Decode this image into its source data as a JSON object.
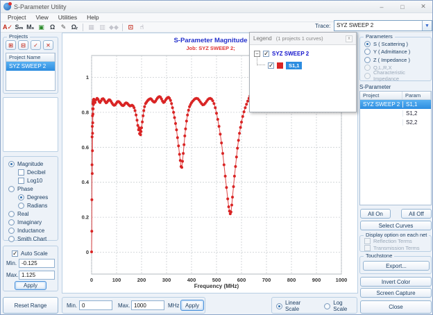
{
  "window": {
    "title": "S-Parameter Utility",
    "controls": [
      {
        "name": "minimize-button",
        "glyph": "–"
      },
      {
        "name": "maximize-button",
        "glyph": "□"
      },
      {
        "name": "close-button",
        "glyph": "✕"
      }
    ]
  },
  "menu": [
    "Project",
    "View",
    "Utilities",
    "Help"
  ],
  "toolbar": {
    "trace_label": "Trace:",
    "trace_value": "SYZ SWEEP 2",
    "items": [
      {
        "name": "ac-check-icon",
        "glyph": "A✓",
        "color": "#c22516"
      },
      {
        "name": "s-to-m-convert-icon",
        "glyph": "Sₘ",
        "color": "#333b44"
      },
      {
        "name": "m-to-s-convert-icon",
        "glyph": "Mₛ",
        "color": "#333b44"
      },
      {
        "name": "import-data-icon",
        "glyph": "▣",
        "color": "#2a8a2a"
      },
      {
        "name": "impedance-omega-icon",
        "glyph": "Ω",
        "color": "#333b44"
      },
      {
        "name": "edit-plot-icon",
        "glyph": "✎",
        "color": "#555"
      },
      {
        "name": "omega-r-icon",
        "glyph": "Ωᵣ",
        "color": "#333b44"
      },
      {
        "sep": true
      },
      {
        "name": "table-column-left-icon",
        "glyph": "▦",
        "color": "#778",
        "disabled": true
      },
      {
        "name": "table-column-right-icon",
        "glyph": "▥",
        "color": "#778",
        "disabled": true
      },
      {
        "name": "markers-icon",
        "glyph": "◆◆",
        "color": "#778",
        "disabled": true
      },
      {
        "sep": true
      },
      {
        "name": "zoom-select-icon",
        "glyph": "⊡",
        "color": "#c22516"
      },
      {
        "name": "pan-hand-icon",
        "glyph": "☝",
        "color": "#667"
      }
    ]
  },
  "projects_panel": {
    "title": "Projects",
    "buttons": [
      {
        "name": "add-project-button",
        "glyph": "⊞"
      },
      {
        "name": "remove-project-button",
        "glyph": "⊟"
      },
      {
        "name": "confirm-project-button",
        "glyph": "✓"
      },
      {
        "name": "delete-project-button",
        "glyph": "✕"
      }
    ],
    "column_header": "Project Name",
    "rows": [
      {
        "label": "SYZ SWEEP 2",
        "selected": true
      }
    ]
  },
  "display_options": {
    "items": [
      {
        "type": "radio",
        "label": "Magnitude",
        "checked": true,
        "indent": 0
      },
      {
        "type": "check",
        "label": "Decibel",
        "checked": false,
        "indent": 1
      },
      {
        "type": "check",
        "label": "Log10",
        "checked": false,
        "indent": 1
      },
      {
        "type": "radio",
        "label": "Phase",
        "checked": false,
        "indent": 0
      },
      {
        "type": "radio",
        "label": "Degrees",
        "checked": true,
        "indent": 1
      },
      {
        "type": "radio",
        "label": "Radians",
        "checked": false,
        "indent": 1
      },
      {
        "type": "radio",
        "label": "Real",
        "checked": false,
        "indent": 0
      },
      {
        "type": "radio",
        "label": "Imaginary",
        "checked": false,
        "indent": 0
      },
      {
        "type": "radio",
        "label": "Inductance",
        "checked": false,
        "indent": 0
      },
      {
        "type": "radio",
        "label": "Smith Chart",
        "checked": false,
        "indent": 0
      }
    ]
  },
  "scale_panel": {
    "auto_scale_label": "Auto Scale",
    "auto_scale_checked": true,
    "min_label": "Min.",
    "min_value": "-0.125",
    "max_label": "Max.",
    "max_value": "1.125",
    "apply_label": "Apply"
  },
  "reset_range_label": "Reset Range",
  "legend": {
    "title": "Legend",
    "count_text": "(1 projects 1 curves)",
    "close_glyph": "x",
    "expander_glyph": "−",
    "project": "SYZ SWEEP 2",
    "curve": "S1,1"
  },
  "parameters_panel": {
    "title": "Parameters",
    "options": [
      {
        "label": "S ( Scattering )",
        "checked": true,
        "disabled": false
      },
      {
        "label": "Y ( Admittance )",
        "checked": false,
        "disabled": false
      },
      {
        "label": "Z ( Impedance )",
        "checked": false,
        "disabled": false
      },
      {
        "label": "Q,L,R,X",
        "checked": false,
        "disabled": true
      },
      {
        "label": "Characteristic Impedance",
        "checked": false,
        "disabled": true
      }
    ]
  },
  "sparameter_panel": {
    "title": "S-Parameter",
    "columns": [
      "Project",
      "Param"
    ],
    "rows": [
      {
        "project": "SYZ SWEEP 2",
        "param": "S1,1",
        "selected": true
      },
      {
        "project": "",
        "param": "S1,2",
        "selected": false
      },
      {
        "project": "",
        "param": "S2,2",
        "selected": false
      }
    ],
    "all_on_label": "All On",
    "all_off_label": "All Off",
    "select_curves_label": "Select Curves"
  },
  "net_options": {
    "title": "Display option on each net",
    "items": [
      {
        "label": "Reflection Terms",
        "checked": false,
        "disabled": true
      },
      {
        "label": "Transmission Terms",
        "checked": false,
        "disabled": true
      }
    ]
  },
  "touchstone": {
    "title": "Touchstone",
    "export_label": "Export..."
  },
  "side_buttons": {
    "invert_color": "Invert Color",
    "screen_capture": "Screen Capture",
    "close": "Close"
  },
  "freq_range": {
    "min_label": "Min.",
    "min_value": "0",
    "max_label": "Max.",
    "max_value": "1000",
    "unit": "MHz",
    "apply_label": "Apply"
  },
  "x_scale": {
    "options": [
      {
        "label": "Linear Scale",
        "checked": true
      },
      {
        "label": "Log Scale",
        "checked": false
      }
    ]
  },
  "chart_data": {
    "type": "line",
    "title": "S-Parameter Magnitude",
    "subtitle": "Job: SYZ SWEEP 2;",
    "xlabel": "Frequency (MHz)",
    "ylabel": "",
    "xlim": [
      0,
      1000
    ],
    "ylim": [
      -0.125,
      1.125
    ],
    "x_ticks": [
      0,
      100,
      200,
      300,
      400,
      500,
      600,
      700,
      800,
      900,
      1000
    ],
    "y_ticks": [
      0,
      0.2,
      0.4,
      0.6,
      0.8,
      1
    ],
    "grid": true,
    "legend_position": "floating-top-right",
    "series": [
      {
        "name": "S1,1",
        "color": "#d92424",
        "marker": "circle",
        "points": [
          [
            0,
            0.002
          ],
          [
            0.8,
            0.12
          ],
          [
            1.2,
            0.3
          ],
          [
            1.6,
            0.5
          ],
          [
            2,
            0.66
          ],
          [
            2.4,
            0.45
          ],
          [
            2.8,
            0.72
          ],
          [
            3.2,
            0.58
          ],
          [
            3.6,
            0.78
          ],
          [
            4,
            0.68
          ],
          [
            4.4,
            0.82
          ],
          [
            4.8,
            0.74
          ],
          [
            5.2,
            0.85
          ],
          [
            5.6,
            0.79
          ],
          [
            6,
            0.86
          ],
          [
            6.5,
            0.82
          ],
          [
            7,
            0.87
          ],
          [
            7.5,
            0.845
          ],
          [
            8,
            0.862
          ],
          [
            9,
            0.875
          ],
          [
            10,
            0.868
          ],
          [
            14,
            0.856
          ],
          [
            18,
            0.872
          ],
          [
            22,
            0.88
          ],
          [
            26,
            0.874
          ],
          [
            30,
            0.862
          ],
          [
            34,
            0.856
          ],
          [
            38,
            0.866
          ],
          [
            42,
            0.876
          ],
          [
            46,
            0.878
          ],
          [
            50,
            0.872
          ],
          [
            54,
            0.862
          ],
          [
            58,
            0.854
          ],
          [
            62,
            0.858
          ],
          [
            66,
            0.866
          ],
          [
            70,
            0.872
          ],
          [
            74,
            0.87
          ],
          [
            78,
            0.862
          ],
          [
            82,
            0.852
          ],
          [
            86,
            0.844
          ],
          [
            90,
            0.84
          ],
          [
            94,
            0.842
          ],
          [
            98,
            0.85
          ],
          [
            102,
            0.858
          ],
          [
            106,
            0.862
          ],
          [
            110,
            0.86
          ],
          [
            114,
            0.854
          ],
          [
            118,
            0.846
          ],
          [
            122,
            0.84
          ],
          [
            126,
            0.838
          ],
          [
            130,
            0.842
          ],
          [
            134,
            0.85
          ],
          [
            138,
            0.854
          ],
          [
            142,
            0.852
          ],
          [
            146,
            0.846
          ],
          [
            150,
            0.84
          ],
          [
            154,
            0.836
          ],
          [
            158,
            0.838
          ],
          [
            162,
            0.841
          ],
          [
            166,
            0.836
          ],
          [
            170,
            0.826
          ],
          [
            174,
            0.81
          ],
          [
            178,
            0.785
          ],
          [
            182,
            0.755
          ],
          [
            185,
            0.725
          ],
          [
            188,
            0.7
          ],
          [
            190,
            0.712
          ],
          [
            192,
            0.678
          ],
          [
            194,
            0.7
          ],
          [
            196,
            0.672
          ],
          [
            198,
            0.69
          ],
          [
            200,
            0.712
          ],
          [
            203,
            0.745
          ],
          [
            206,
            0.78
          ],
          [
            209,
            0.81
          ],
          [
            212,
            0.832
          ],
          [
            216,
            0.85
          ],
          [
            220,
            0.858
          ],
          [
            224,
            0.866
          ],
          [
            228,
            0.872
          ],
          [
            232,
            0.876
          ],
          [
            236,
            0.878
          ],
          [
            240,
            0.874
          ],
          [
            244,
            0.866
          ],
          [
            248,
            0.86
          ],
          [
            252,
            0.858
          ],
          [
            256,
            0.864
          ],
          [
            260,
            0.874
          ],
          [
            264,
            0.882
          ],
          [
            268,
            0.888
          ],
          [
            272,
            0.89
          ],
          [
            276,
            0.886
          ],
          [
            280,
            0.876
          ],
          [
            284,
            0.864
          ],
          [
            288,
            0.856
          ],
          [
            292,
            0.86
          ],
          [
            296,
            0.87
          ],
          [
            300,
            0.878
          ],
          [
            304,
            0.884
          ],
          [
            308,
            0.886
          ],
          [
            312,
            0.88
          ],
          [
            316,
            0.868
          ],
          [
            320,
            0.85
          ],
          [
            324,
            0.826
          ],
          [
            328,
            0.8
          ],
          [
            332,
            0.77
          ],
          [
            336,
            0.736
          ],
          [
            340,
            0.7
          ],
          [
            344,
            0.655
          ],
          [
            348,
            0.608
          ],
          [
            352,
            0.56
          ],
          [
            355,
            0.525
          ],
          [
            358,
            0.49
          ],
          [
            361,
            0.485
          ],
          [
            364,
            0.52
          ],
          [
            367,
            0.565
          ],
          [
            370,
            0.615
          ],
          [
            373,
            0.665
          ],
          [
            376,
            0.705
          ],
          [
            380,
            0.75
          ],
          [
            384,
            0.785
          ],
          [
            388,
            0.812
          ],
          [
            392,
            0.832
          ],
          [
            396,
            0.845
          ],
          [
            400,
            0.855
          ],
          [
            405,
            0.864
          ],
          [
            410,
            0.872
          ],
          [
            415,
            0.878
          ],
          [
            420,
            0.88
          ],
          [
            425,
            0.878
          ],
          [
            430,
            0.87
          ],
          [
            435,
            0.86
          ],
          [
            440,
            0.85
          ],
          [
            445,
            0.843
          ],
          [
            450,
            0.845
          ],
          [
            455,
            0.852
          ],
          [
            460,
            0.862
          ],
          [
            465,
            0.872
          ],
          [
            470,
            0.878
          ],
          [
            475,
            0.88
          ],
          [
            480,
            0.876
          ],
          [
            485,
            0.866
          ],
          [
            490,
            0.85
          ],
          [
            495,
            0.826
          ],
          [
            500,
            0.795
          ],
          [
            505,
            0.76
          ],
          [
            510,
            0.72
          ],
          [
            515,
            0.675
          ],
          [
            520,
            0.625
          ],
          [
            525,
            0.565
          ],
          [
            530,
            0.5
          ],
          [
            535,
            0.435
          ],
          [
            540,
            0.37
          ],
          [
            545,
            0.305
          ],
          [
            549,
            0.26
          ],
          [
            552,
            0.235
          ],
          [
            555,
            0.22
          ],
          [
            558,
            0.23
          ],
          [
            561,
            0.27
          ],
          [
            564,
            0.315
          ],
          [
            568,
            0.375
          ],
          [
            572,
            0.435
          ],
          [
            576,
            0.49
          ],
          [
            580,
            0.545
          ],
          [
            584,
            0.595
          ],
          [
            588,
            0.64
          ],
          [
            592,
            0.68
          ],
          [
            596,
            0.714
          ],
          [
            600,
            0.744
          ],
          [
            605,
            0.776
          ],
          [
            610,
            0.803
          ],
          [
            615,
            0.826
          ],
          [
            620,
            0.846
          ],
          [
            625,
            0.864
          ],
          [
            630,
            0.88
          ],
          [
            634,
            0.893
          ],
          [
            638,
            0.904
          ],
          [
            641,
            0.912
          ]
        ]
      }
    ]
  }
}
